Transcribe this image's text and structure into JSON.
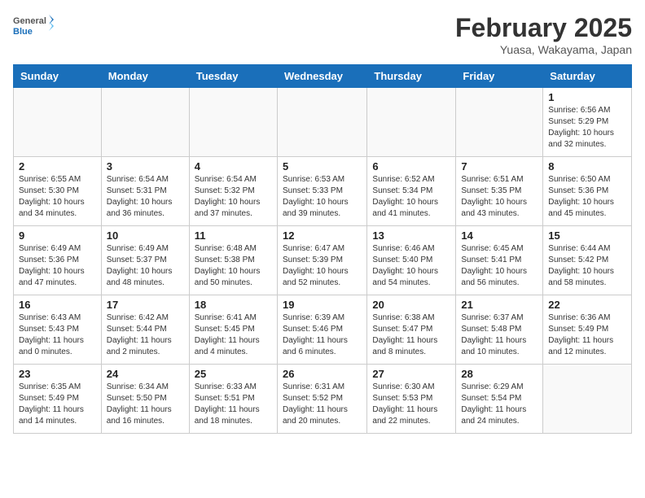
{
  "header": {
    "logo_text_general": "General",
    "logo_text_blue": "Blue",
    "month_title": "February 2025",
    "location": "Yuasa, Wakayama, Japan"
  },
  "calendar": {
    "weekdays": [
      "Sunday",
      "Monday",
      "Tuesday",
      "Wednesday",
      "Thursday",
      "Friday",
      "Saturday"
    ],
    "weeks": [
      [
        {
          "day": "",
          "info": ""
        },
        {
          "day": "",
          "info": ""
        },
        {
          "day": "",
          "info": ""
        },
        {
          "day": "",
          "info": ""
        },
        {
          "day": "",
          "info": ""
        },
        {
          "day": "",
          "info": ""
        },
        {
          "day": "1",
          "info": "Sunrise: 6:56 AM\nSunset: 5:29 PM\nDaylight: 10 hours and 32 minutes."
        }
      ],
      [
        {
          "day": "2",
          "info": "Sunrise: 6:55 AM\nSunset: 5:30 PM\nDaylight: 10 hours and 34 minutes."
        },
        {
          "day": "3",
          "info": "Sunrise: 6:54 AM\nSunset: 5:31 PM\nDaylight: 10 hours and 36 minutes."
        },
        {
          "day": "4",
          "info": "Sunrise: 6:54 AM\nSunset: 5:32 PM\nDaylight: 10 hours and 37 minutes."
        },
        {
          "day": "5",
          "info": "Sunrise: 6:53 AM\nSunset: 5:33 PM\nDaylight: 10 hours and 39 minutes."
        },
        {
          "day": "6",
          "info": "Sunrise: 6:52 AM\nSunset: 5:34 PM\nDaylight: 10 hours and 41 minutes."
        },
        {
          "day": "7",
          "info": "Sunrise: 6:51 AM\nSunset: 5:35 PM\nDaylight: 10 hours and 43 minutes."
        },
        {
          "day": "8",
          "info": "Sunrise: 6:50 AM\nSunset: 5:36 PM\nDaylight: 10 hours and 45 minutes."
        }
      ],
      [
        {
          "day": "9",
          "info": "Sunrise: 6:49 AM\nSunset: 5:36 PM\nDaylight: 10 hours and 47 minutes."
        },
        {
          "day": "10",
          "info": "Sunrise: 6:49 AM\nSunset: 5:37 PM\nDaylight: 10 hours and 48 minutes."
        },
        {
          "day": "11",
          "info": "Sunrise: 6:48 AM\nSunset: 5:38 PM\nDaylight: 10 hours and 50 minutes."
        },
        {
          "day": "12",
          "info": "Sunrise: 6:47 AM\nSunset: 5:39 PM\nDaylight: 10 hours and 52 minutes."
        },
        {
          "day": "13",
          "info": "Sunrise: 6:46 AM\nSunset: 5:40 PM\nDaylight: 10 hours and 54 minutes."
        },
        {
          "day": "14",
          "info": "Sunrise: 6:45 AM\nSunset: 5:41 PM\nDaylight: 10 hours and 56 minutes."
        },
        {
          "day": "15",
          "info": "Sunrise: 6:44 AM\nSunset: 5:42 PM\nDaylight: 10 hours and 58 minutes."
        }
      ],
      [
        {
          "day": "16",
          "info": "Sunrise: 6:43 AM\nSunset: 5:43 PM\nDaylight: 11 hours and 0 minutes."
        },
        {
          "day": "17",
          "info": "Sunrise: 6:42 AM\nSunset: 5:44 PM\nDaylight: 11 hours and 2 minutes."
        },
        {
          "day": "18",
          "info": "Sunrise: 6:41 AM\nSunset: 5:45 PM\nDaylight: 11 hours and 4 minutes."
        },
        {
          "day": "19",
          "info": "Sunrise: 6:39 AM\nSunset: 5:46 PM\nDaylight: 11 hours and 6 minutes."
        },
        {
          "day": "20",
          "info": "Sunrise: 6:38 AM\nSunset: 5:47 PM\nDaylight: 11 hours and 8 minutes."
        },
        {
          "day": "21",
          "info": "Sunrise: 6:37 AM\nSunset: 5:48 PM\nDaylight: 11 hours and 10 minutes."
        },
        {
          "day": "22",
          "info": "Sunrise: 6:36 AM\nSunset: 5:49 PM\nDaylight: 11 hours and 12 minutes."
        }
      ],
      [
        {
          "day": "23",
          "info": "Sunrise: 6:35 AM\nSunset: 5:49 PM\nDaylight: 11 hours and 14 minutes."
        },
        {
          "day": "24",
          "info": "Sunrise: 6:34 AM\nSunset: 5:50 PM\nDaylight: 11 hours and 16 minutes."
        },
        {
          "day": "25",
          "info": "Sunrise: 6:33 AM\nSunset: 5:51 PM\nDaylight: 11 hours and 18 minutes."
        },
        {
          "day": "26",
          "info": "Sunrise: 6:31 AM\nSunset: 5:52 PM\nDaylight: 11 hours and 20 minutes."
        },
        {
          "day": "27",
          "info": "Sunrise: 6:30 AM\nSunset: 5:53 PM\nDaylight: 11 hours and 22 minutes."
        },
        {
          "day": "28",
          "info": "Sunrise: 6:29 AM\nSunset: 5:54 PM\nDaylight: 11 hours and 24 minutes."
        },
        {
          "day": "",
          "info": ""
        }
      ]
    ]
  }
}
